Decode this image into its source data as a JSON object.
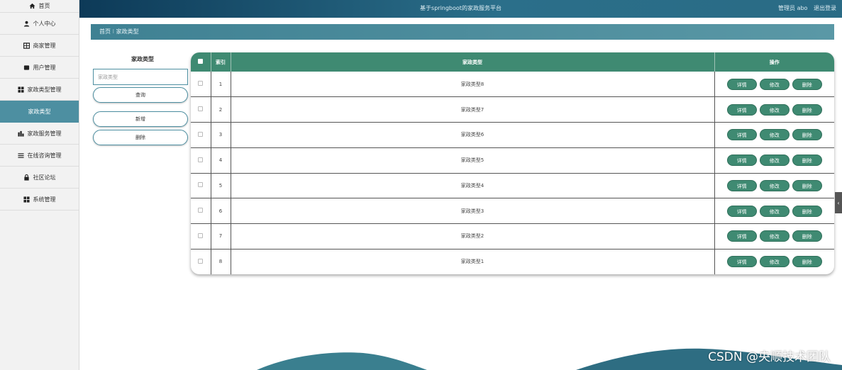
{
  "app": {
    "title": "基于springboot的家政服务平台",
    "user_label": "管理员 abo",
    "logout_label": "退出登录"
  },
  "sidebar": {
    "items": [
      {
        "label": "首页",
        "icon": "home-icon"
      },
      {
        "label": "个人中心",
        "icon": "user-icon"
      },
      {
        "label": "商家管理",
        "icon": "grid-icon"
      },
      {
        "label": "用户管理",
        "icon": "square-icon"
      },
      {
        "label": "家政类型管理",
        "icon": "apps-icon"
      },
      {
        "label": "家政类型",
        "icon": ""
      },
      {
        "label": "家政服务管理",
        "icon": "chart-icon"
      },
      {
        "label": "在线咨询管理",
        "icon": "menu-icon"
      },
      {
        "label": "社区论坛",
        "icon": "lock-icon"
      },
      {
        "label": "系统管理",
        "icon": "apps-icon"
      }
    ]
  },
  "breadcrumb": {
    "text": "首页 ⁝ 家政类型"
  },
  "search": {
    "label": "家政类型",
    "placeholder": "家政类型",
    "query_button": "查询",
    "add_button": "新增",
    "delete_button": "删除"
  },
  "table": {
    "headers": [
      "",
      "索引",
      "家政类型",
      "操作"
    ],
    "rows": [
      {
        "index": "1",
        "type": "家政类型8"
      },
      {
        "index": "2",
        "type": "家政类型7"
      },
      {
        "index": "3",
        "type": "家政类型6"
      },
      {
        "index": "4",
        "type": "家政类型5"
      },
      {
        "index": "5",
        "type": "家政类型4"
      },
      {
        "index": "6",
        "type": "家政类型3"
      },
      {
        "index": "7",
        "type": "家政类型2"
      },
      {
        "index": "8",
        "type": "家政类型1"
      }
    ],
    "actions": {
      "detail": "详情",
      "edit": "修改",
      "delete": "删除"
    }
  },
  "watermark": "CSDN @央顺技术团队",
  "colors": {
    "accent": "#3f8a72",
    "sidebar_active": "#4d8fa1",
    "topbar": "#0d3a58"
  }
}
